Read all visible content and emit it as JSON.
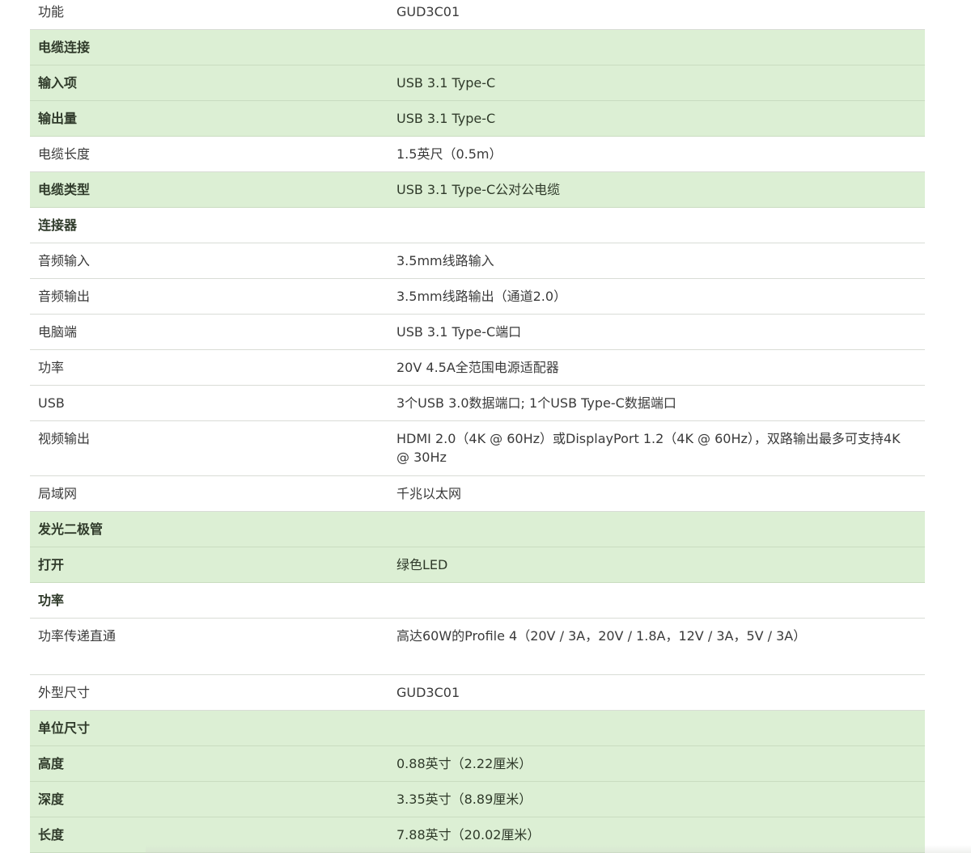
{
  "rows": [
    {
      "label": "功能",
      "value": "GUD3C01",
      "style": "plain"
    },
    {
      "label": "电缆连接",
      "value": "",
      "style": "green-header"
    },
    {
      "label": "输入项",
      "value": "USB 3.1 Type-C",
      "style": "green"
    },
    {
      "label": "输出量",
      "value": "USB 3.1 Type-C",
      "style": "green"
    },
    {
      "label": "电缆长度",
      "value": "1.5英尺（0.5m）",
      "style": "plain"
    },
    {
      "label": "电缆类型",
      "value": "USB 3.1 Type-C公对公电缆",
      "style": "green"
    },
    {
      "label": "连接器",
      "value": "",
      "style": "plain-header"
    },
    {
      "label": "音频输入",
      "value": "3.5mm线路输入",
      "style": "plain"
    },
    {
      "label": "音频输出",
      "value": "3.5mm线路输出（通道2.0）",
      "style": "plain"
    },
    {
      "label": "电脑端",
      "value": "USB 3.1 Type-C端口",
      "style": "plain"
    },
    {
      "label": "功率",
      "value": "20V 4.5A全范围电源适配器",
      "style": "plain"
    },
    {
      "label": "USB",
      "value": "3个USB 3.0数据端口; 1个USB Type-C数据端口",
      "style": "plain"
    },
    {
      "label": "视频输出",
      "value": "HDMI 2.0（4K @ 60Hz）或DisplayPort 1.2（4K @ 60Hz），双路输出最多可支持4K @ 30Hz",
      "style": "plain-tall2"
    },
    {
      "label": "局域网",
      "value": "千兆以太网",
      "style": "plain"
    },
    {
      "label": "发光二极管",
      "value": "",
      "style": "green-header"
    },
    {
      "label": "打开",
      "value": "绿色LED",
      "style": "green"
    },
    {
      "label": "功率",
      "value": "",
      "style": "plain-header"
    },
    {
      "label": "功率传递直通",
      "value": "高达60W的Profile 4（20V / 3A，20V / 1.8A，12V / 3A，5V / 3A）",
      "style": "plain-tall3"
    },
    {
      "label": "外型尺寸",
      "value": "GUD3C01",
      "style": "plain"
    },
    {
      "label": "单位尺寸",
      "value": "",
      "style": "green-header"
    },
    {
      "label": "高度",
      "value": "0.88英寸（2.22厘米）",
      "style": "green"
    },
    {
      "label": "深度",
      "value": "3.35英寸（8.89厘米）",
      "style": "green"
    },
    {
      "label": "长度",
      "value": "7.88英寸（20.02厘米）",
      "style": "green"
    }
  ],
  "colors": {
    "row_green": "#dcefd4",
    "row_white": "#ffffff",
    "divider": "#d9dcd6",
    "text": "#3a3a3a"
  }
}
